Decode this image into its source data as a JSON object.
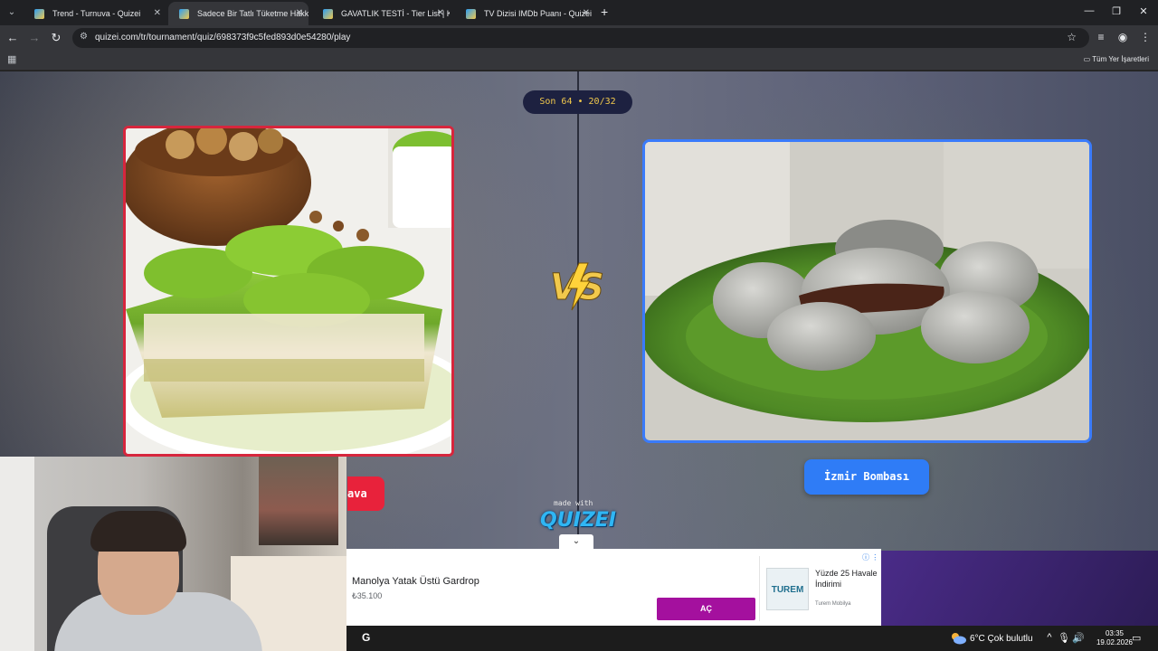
{
  "browser": {
    "tabs": [
      {
        "label": "Trend - Turnuva - Quizei",
        "active": false
      },
      {
        "label": "Sadece Bir Tatlı Tüketme Hakkı",
        "active": true
      },
      {
        "label": "GAVATLIK TESTİ - Tier List | Kör",
        "active": false
      },
      {
        "label": "TV Dizisi IMDb Puanı - Quizei",
        "active": false
      }
    ],
    "url": "quizei.com/tr/tournament/quiz/698373f9c5fed893d0e54280/play",
    "bookmarks_folder": "Tüm Yer İşaretleri"
  },
  "quiz": {
    "round_label": "Son 64 • 20/32",
    "left_option": {
      "label": "ava",
      "image": "kunefe-style pistachio dessert"
    },
    "right_option": {
      "label": "İzmir Bombası",
      "image": "izmir bomba chocolate dessert"
    },
    "vs_text": "VS",
    "made_with": "made with",
    "brand": "QUIZEI",
    "colors": {
      "left_accent": "#e8223b",
      "right_accent": "#2f7cf6",
      "round_text": "#f2c94c"
    }
  },
  "ad": {
    "title": "Manolya Yatak Üstü Gardrop",
    "price": "₺35.100",
    "button": "AÇ",
    "headline": "Yüzde 25 Havale İndirimi",
    "brand": "Turem Mobilya",
    "logo_text": "TUREM",
    "accent": "#a4109e"
  },
  "taskbar": {
    "weather": "6°C  Çok bulutlu",
    "time": "03:35",
    "date": "19.02.2026"
  }
}
